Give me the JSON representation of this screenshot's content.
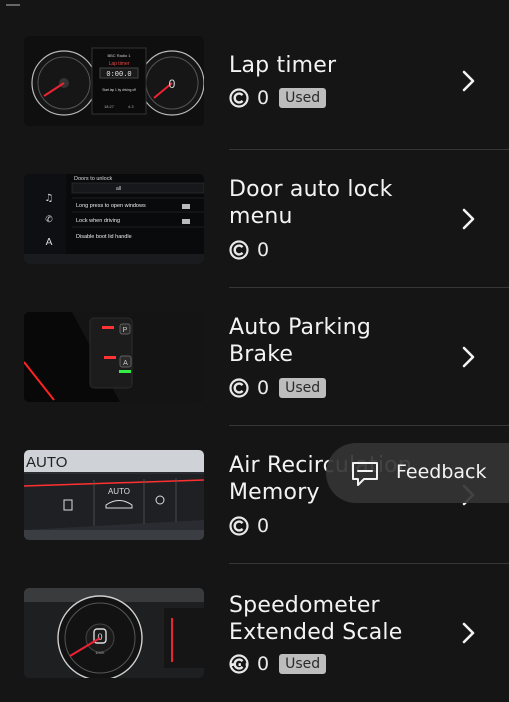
{
  "items": [
    {
      "title_lines": [
        "Lap timer"
      ],
      "count": "0",
      "badge": "Used",
      "thumb": {
        "kind": "cluster",
        "texts": [
          "Lap timer",
          "0:00.0",
          "Start lap 1 by driving off",
          "BBC Radio 1",
          "18:27",
          "4.3"
        ]
      }
    },
    {
      "title_lines": [
        "Door auto lock",
        "menu"
      ],
      "count": "0",
      "badge": "",
      "thumb": {
        "kind": "menu",
        "texts": [
          "Doors to unlock",
          "all",
          "Long press to open windows",
          "Lock when driving",
          "Disable boot lid handle"
        ]
      }
    },
    {
      "title_lines": [
        "Auto Parking",
        "Brake"
      ],
      "count": "0",
      "badge": "Used",
      "thumb": {
        "kind": "brake",
        "texts": [
          "P",
          "A"
        ]
      }
    },
    {
      "title_lines": [
        "Air Recirculation",
        "Memory"
      ],
      "count": "0",
      "badge": "",
      "thumb": {
        "kind": "air",
        "texts": [
          "AUTO",
          "AUTO"
        ]
      }
    },
    {
      "title_lines": [
        "Speedometer",
        "Extended Scale ..."
      ],
      "count": "0",
      "badge": "Used",
      "thumb": {
        "kind": "speedo",
        "texts": [
          "0",
          "km/h"
        ]
      }
    }
  ],
  "feedback": {
    "label": "Feedback"
  },
  "colors": {
    "background": "#151515",
    "badge": "#bdbdbd",
    "divider": "#363636"
  }
}
